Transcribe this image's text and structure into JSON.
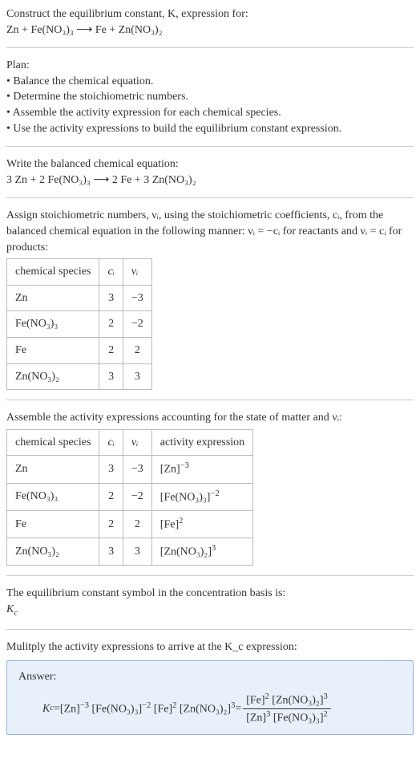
{
  "header": {
    "title_line1": "Construct the equilibrium constant, K, expression for:",
    "equation": "Zn + Fe(NO₃)₃  ⟶  Fe + Zn(NO₃)₂"
  },
  "plan": {
    "label": "Plan:",
    "items": [
      "• Balance the chemical equation.",
      "• Determine the stoichiometric numbers.",
      "• Assemble the activity expression for each chemical species.",
      "• Use the activity expressions to build the equilibrium constant expression."
    ]
  },
  "balanced": {
    "label": "Write the balanced chemical equation:",
    "equation": "3 Zn + 2 Fe(NO₃)₃  ⟶  2 Fe + 3 Zn(NO₃)₂"
  },
  "assign": {
    "text": "Assign stoichiometric numbers, νᵢ, using the stoichiometric coefficients, cᵢ, from the balanced chemical equation in the following manner: νᵢ = −cᵢ for reactants and νᵢ = cᵢ for products:",
    "table": {
      "headers": [
        "chemical species",
        "cᵢ",
        "νᵢ"
      ],
      "rows": [
        [
          "Zn",
          "3",
          "−3"
        ],
        [
          "Fe(NO₃)₃",
          "2",
          "−2"
        ],
        [
          "Fe",
          "2",
          "2"
        ],
        [
          "Zn(NO₃)₂",
          "3",
          "3"
        ]
      ]
    }
  },
  "assemble": {
    "text": "Assemble the activity expressions accounting for the state of matter and νᵢ:",
    "table": {
      "headers": [
        "chemical species",
        "cᵢ",
        "νᵢ",
        "activity expression"
      ],
      "rows": [
        {
          "species": "Zn",
          "c": "3",
          "v": "−3",
          "expr_base": "[Zn]",
          "expr_sup": "−3"
        },
        {
          "species": "Fe(NO₃)₃",
          "c": "2",
          "v": "−2",
          "expr_base": "[Fe(NO₃)₃]",
          "expr_sup": "−2"
        },
        {
          "species": "Fe",
          "c": "2",
          "v": "2",
          "expr_base": "[Fe]",
          "expr_sup": "2"
        },
        {
          "species": "Zn(NO₃)₂",
          "c": "3",
          "v": "3",
          "expr_base": "[Zn(NO₃)₂]",
          "expr_sup": "3"
        }
      ]
    }
  },
  "symbol": {
    "line1": "The equilibrium constant symbol in the concentration basis is:",
    "line2": "K",
    "line2_sub": "c"
  },
  "multiply": {
    "text": "Mulitply the activity expressions to arrive at the K_c expression:"
  },
  "answer": {
    "label": "Answer:",
    "lhs_k": "K",
    "lhs_k_sub": "c",
    "eq": " = ",
    "t1_base": "[Zn]",
    "t1_sup": "−3",
    "t2_base": "[Fe(NO₃)₃]",
    "t2_sup": "−2",
    "t3_base": "[Fe]",
    "t3_sup": "2",
    "t4_base": "[Zn(NO₃)₂]",
    "t4_sup": "3",
    "eq2": " = ",
    "num1_base": "[Fe]",
    "num1_sup": "2",
    "num2_base": "[Zn(NO₃)₂]",
    "num2_sup": "3",
    "den1_base": "[Zn]",
    "den1_sup": "3",
    "den2_base": "[Fe(NO₃)₃]",
    "den2_sup": "2"
  }
}
